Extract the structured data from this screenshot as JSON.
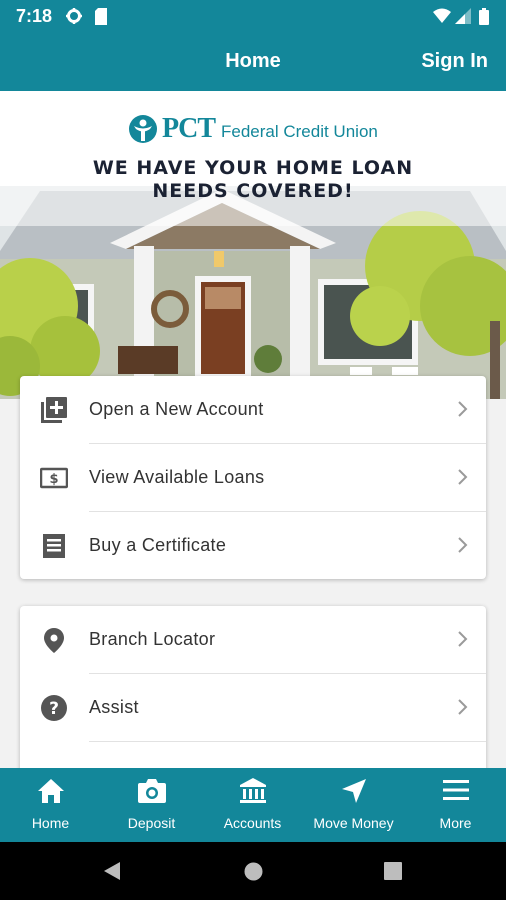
{
  "status_bar": {
    "time": "7:18"
  },
  "app_bar": {
    "title": "Home",
    "sign_in": "Sign In"
  },
  "hero": {
    "logo_pct": "PCT",
    "logo_tagline": "Federal Credit Union",
    "headline_line1": "WE HAVE YOUR HOME LOAN",
    "headline_line2": "NEEDS COVERED!"
  },
  "card1": {
    "items": [
      {
        "label": "Open a New Account",
        "icon": "add-box-icon"
      },
      {
        "label": "View Available Loans",
        "icon": "money-icon"
      },
      {
        "label": "Buy a Certificate",
        "icon": "certificate-icon"
      }
    ]
  },
  "card2": {
    "items": [
      {
        "label": "Branch Locator",
        "icon": "location-pin-icon"
      },
      {
        "label": "Assist",
        "icon": "help-icon"
      }
    ]
  },
  "bottom_nav": {
    "items": [
      {
        "label": "Home",
        "icon": "home-icon"
      },
      {
        "label": "Deposit",
        "icon": "camera-icon"
      },
      {
        "label": "Accounts",
        "icon": "bank-icon"
      },
      {
        "label": "Move Money",
        "icon": "navigation-icon"
      },
      {
        "label": "More",
        "icon": "menu-icon"
      }
    ]
  },
  "colors": {
    "primary": "#13879a",
    "text": "#333333",
    "icon": "#555555"
  }
}
